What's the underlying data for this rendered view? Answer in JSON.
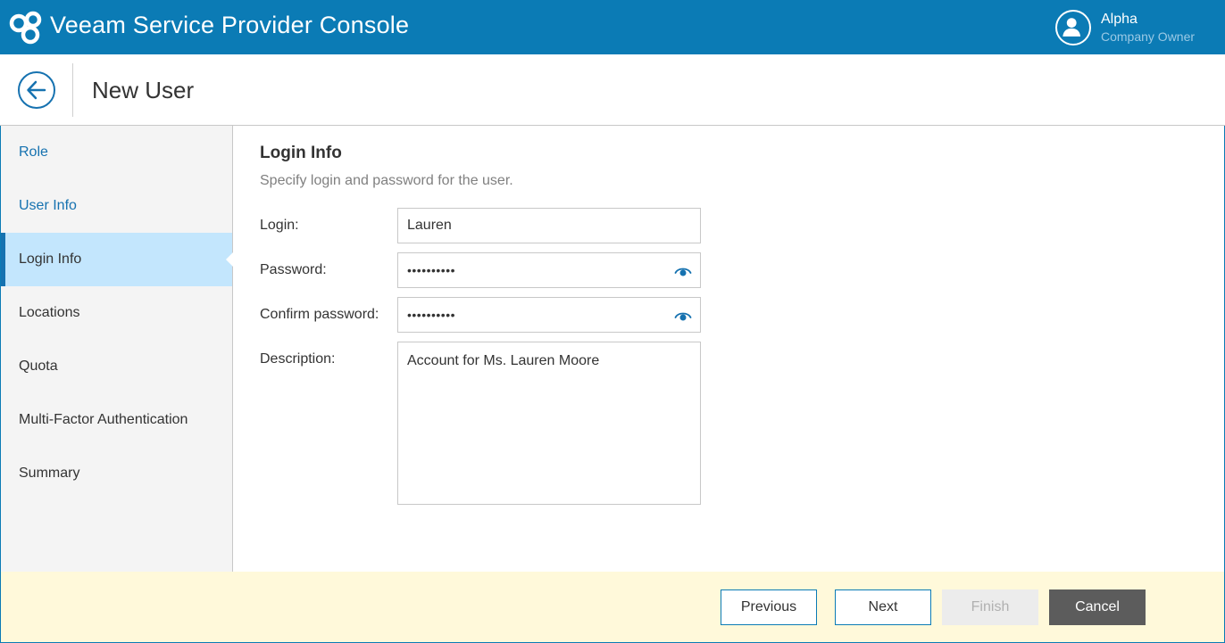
{
  "app": {
    "title": "Veeam Service Provider Console",
    "accent_color": "#0b7bb5",
    "logo_icon": "veeam-logo-icon"
  },
  "user": {
    "name": "Alpha",
    "role": "Company Owner",
    "avatar_icon": "user-avatar-icon"
  },
  "page": {
    "title": "New User",
    "back_icon": "arrow-left-icon"
  },
  "steps": [
    {
      "label": "Role",
      "state": "done"
    },
    {
      "label": "User Info",
      "state": "done"
    },
    {
      "label": "Login Info",
      "state": "active"
    },
    {
      "label": "Locations",
      "state": "pending"
    },
    {
      "label": "Quota",
      "state": "pending"
    },
    {
      "label": "Multi-Factor Authentication",
      "state": "pending"
    },
    {
      "label": "Summary",
      "state": "pending"
    }
  ],
  "form": {
    "title": "Login Info",
    "description": "Specify login and password for the user.",
    "login_label": "Login:",
    "login_value": "Lauren",
    "password_label": "Password:",
    "password_value": "••••••••••",
    "confirm_label": "Confirm password:",
    "confirm_value": "••••••••••",
    "show_password_icon": "eye-icon",
    "description_label": "Description:",
    "description_value": "Account for Ms. Lauren Moore"
  },
  "buttons": {
    "previous": "Previous",
    "next": "Next",
    "finish": "Finish",
    "cancel": "Cancel"
  }
}
